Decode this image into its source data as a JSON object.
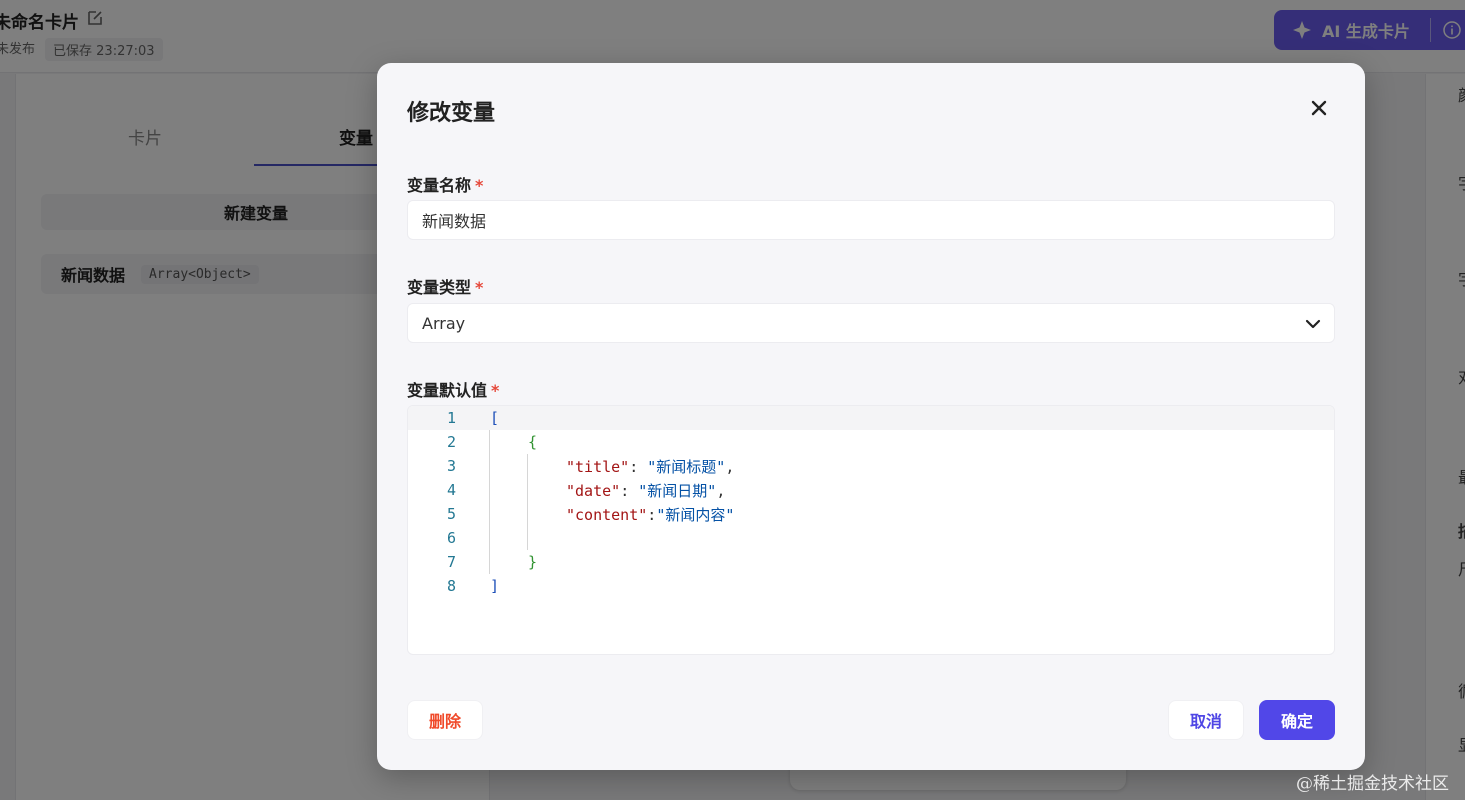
{
  "header": {
    "card_title": "未命名卡片",
    "publish_status": "未发布",
    "save_status": "已保存 23:27:03",
    "ai_button_label": "AI 生成卡片"
  },
  "left_panel": {
    "tabs": [
      {
        "label": "卡片"
      },
      {
        "label": "变量"
      }
    ],
    "new_variable_label": "新建变量",
    "variables": [
      {
        "name": "新闻数据",
        "type": "Array<Object>"
      }
    ]
  },
  "right_panel": {
    "chars": [
      "颜",
      "字",
      "字",
      "对",
      "最",
      "描",
      "尺",
      "循",
      "显"
    ]
  },
  "watermark": "@稀土掘金技术社区",
  "modal": {
    "title": "修改变量",
    "name_field": {
      "label": "变量名称",
      "required_mark": "*",
      "value": "新闻数据"
    },
    "type_field": {
      "label": "变量类型",
      "required_mark": "*",
      "value": "Array"
    },
    "default_field": {
      "label": "变量默认值",
      "required_mark": "*",
      "line_numbers": [
        "1",
        "2",
        "3",
        "4",
        "5",
        "6",
        "7",
        "8"
      ],
      "code": {
        "l1": "[",
        "l2": "{",
        "l3_key": "\"title\"",
        "l3_sep": ": ",
        "l3_val": "\"新闻标题\"",
        "l3_comma": ",",
        "l4_key": "\"date\"",
        "l4_sep": ": ",
        "l4_val": "\"新闻日期\"",
        "l4_comma": ",",
        "l5_key": "\"content\"",
        "l5_sep": ":",
        "l5_val": "\"新闻内容\"",
        "l7": "}",
        "l8": "]"
      }
    },
    "delete_label": "删除",
    "cancel_label": "取消",
    "confirm_label": "确定"
  },
  "colors": {
    "primary": "#5147e8",
    "danger": "#f04a2a",
    "overlay": "rgba(0,0,0,0.5)"
  }
}
